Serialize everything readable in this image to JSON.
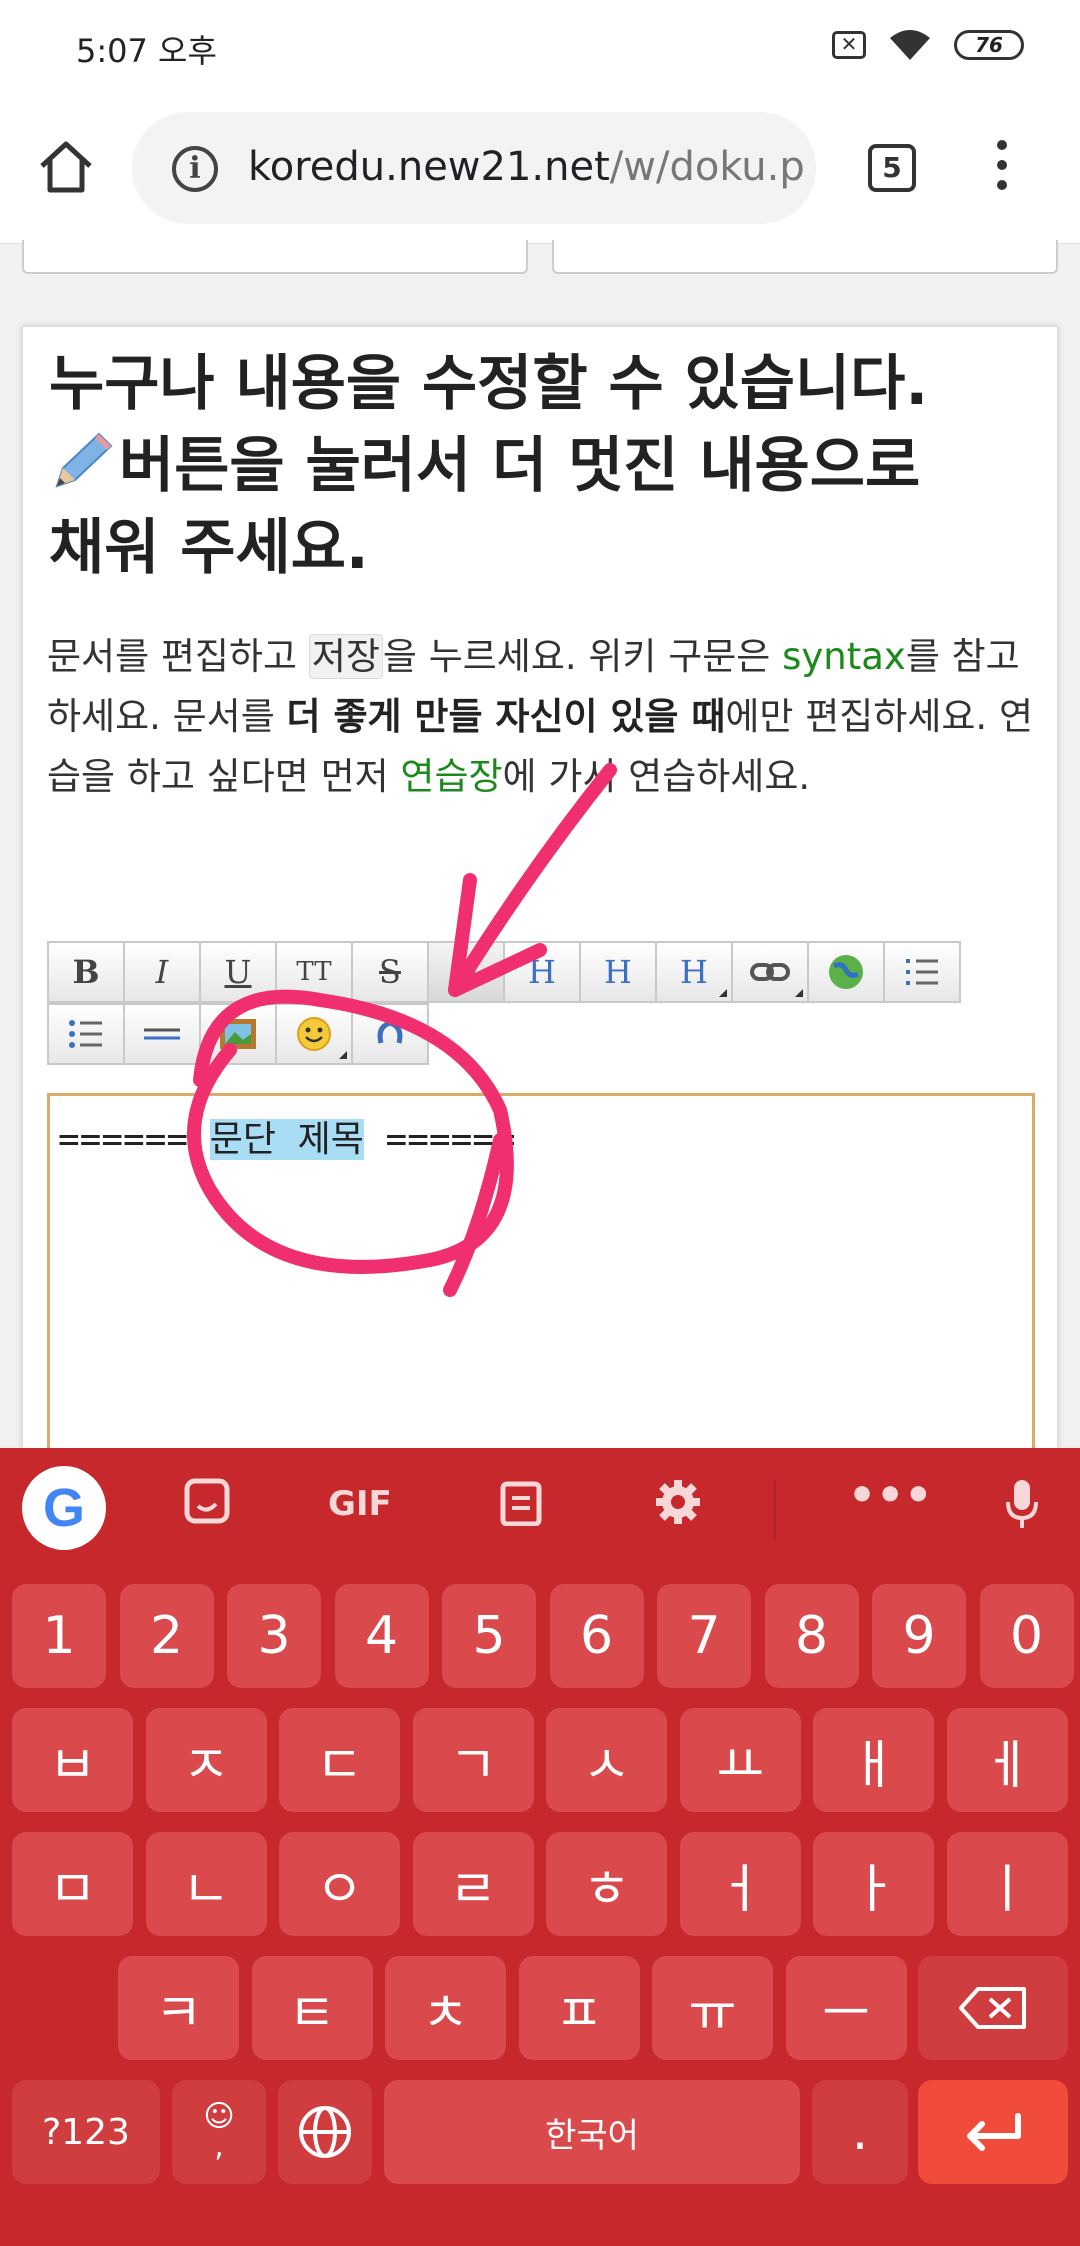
{
  "status": {
    "time": "5:07 오후",
    "battery": "76"
  },
  "browser": {
    "url_host": "koredu.new21.net",
    "url_path": "/w/doku.p",
    "tab_count": "5"
  },
  "page": {
    "heading_line1": "누구나 내용을 수정할 수 있습니다.",
    "heading_line2": "버튼을 눌러서 더 멋진 내용으로",
    "heading_line3": "채워 주세요.",
    "intro": {
      "p1": "문서를 편집하고 ",
      "save_word": "저장",
      "p2": "을 누르세요. 위키 구문은 ",
      "syntax_link": "syntax",
      "p3": "를 참고하세요. 문서를 ",
      "bold": "더 좋게 만들 자신이 있을 때",
      "p4": "에만 편집하세요. 연습을 하고 싶다면 먼저 ",
      "sandbox_link": "연습장",
      "p5": "에 가서 연습하세요."
    }
  },
  "toolbar": {
    "bold": "B",
    "italic": "I",
    "underline": "U",
    "mono": "TT",
    "strike": "S",
    "h_same": "H",
    "h_lower": "H",
    "h_higher": "H",
    "h_select": "H"
  },
  "editor": {
    "prefix": "====== ",
    "selected": "문단 제목",
    "suffix": " ======"
  },
  "keyboard": {
    "gif": "GIF",
    "row_numbers": [
      "1",
      "2",
      "3",
      "4",
      "5",
      "6",
      "7",
      "8",
      "9",
      "0"
    ],
    "row1": [
      "ㅂ",
      "ㅈ",
      "ㄷ",
      "ㄱ",
      "ㅅ",
      "ㅛ",
      "ㅐ",
      "ㅔ"
    ],
    "row2": [
      "ㅁ",
      "ㄴ",
      "ㅇ",
      "ㄹ",
      "ㅎ",
      "ㅓ",
      "ㅏ",
      "ㅣ"
    ],
    "row3": [
      "ㅋ",
      "ㅌ",
      "ㅊ",
      "ㅍ",
      "ㅠ",
      "ㅡ"
    ],
    "sym_key": "?123",
    "comma": ",",
    "space_label": "한국어",
    "period": "."
  },
  "colors": {
    "keyboard_bg": "#c6282b",
    "annotation": "#f0306e",
    "link": "#1a8a1a"
  }
}
